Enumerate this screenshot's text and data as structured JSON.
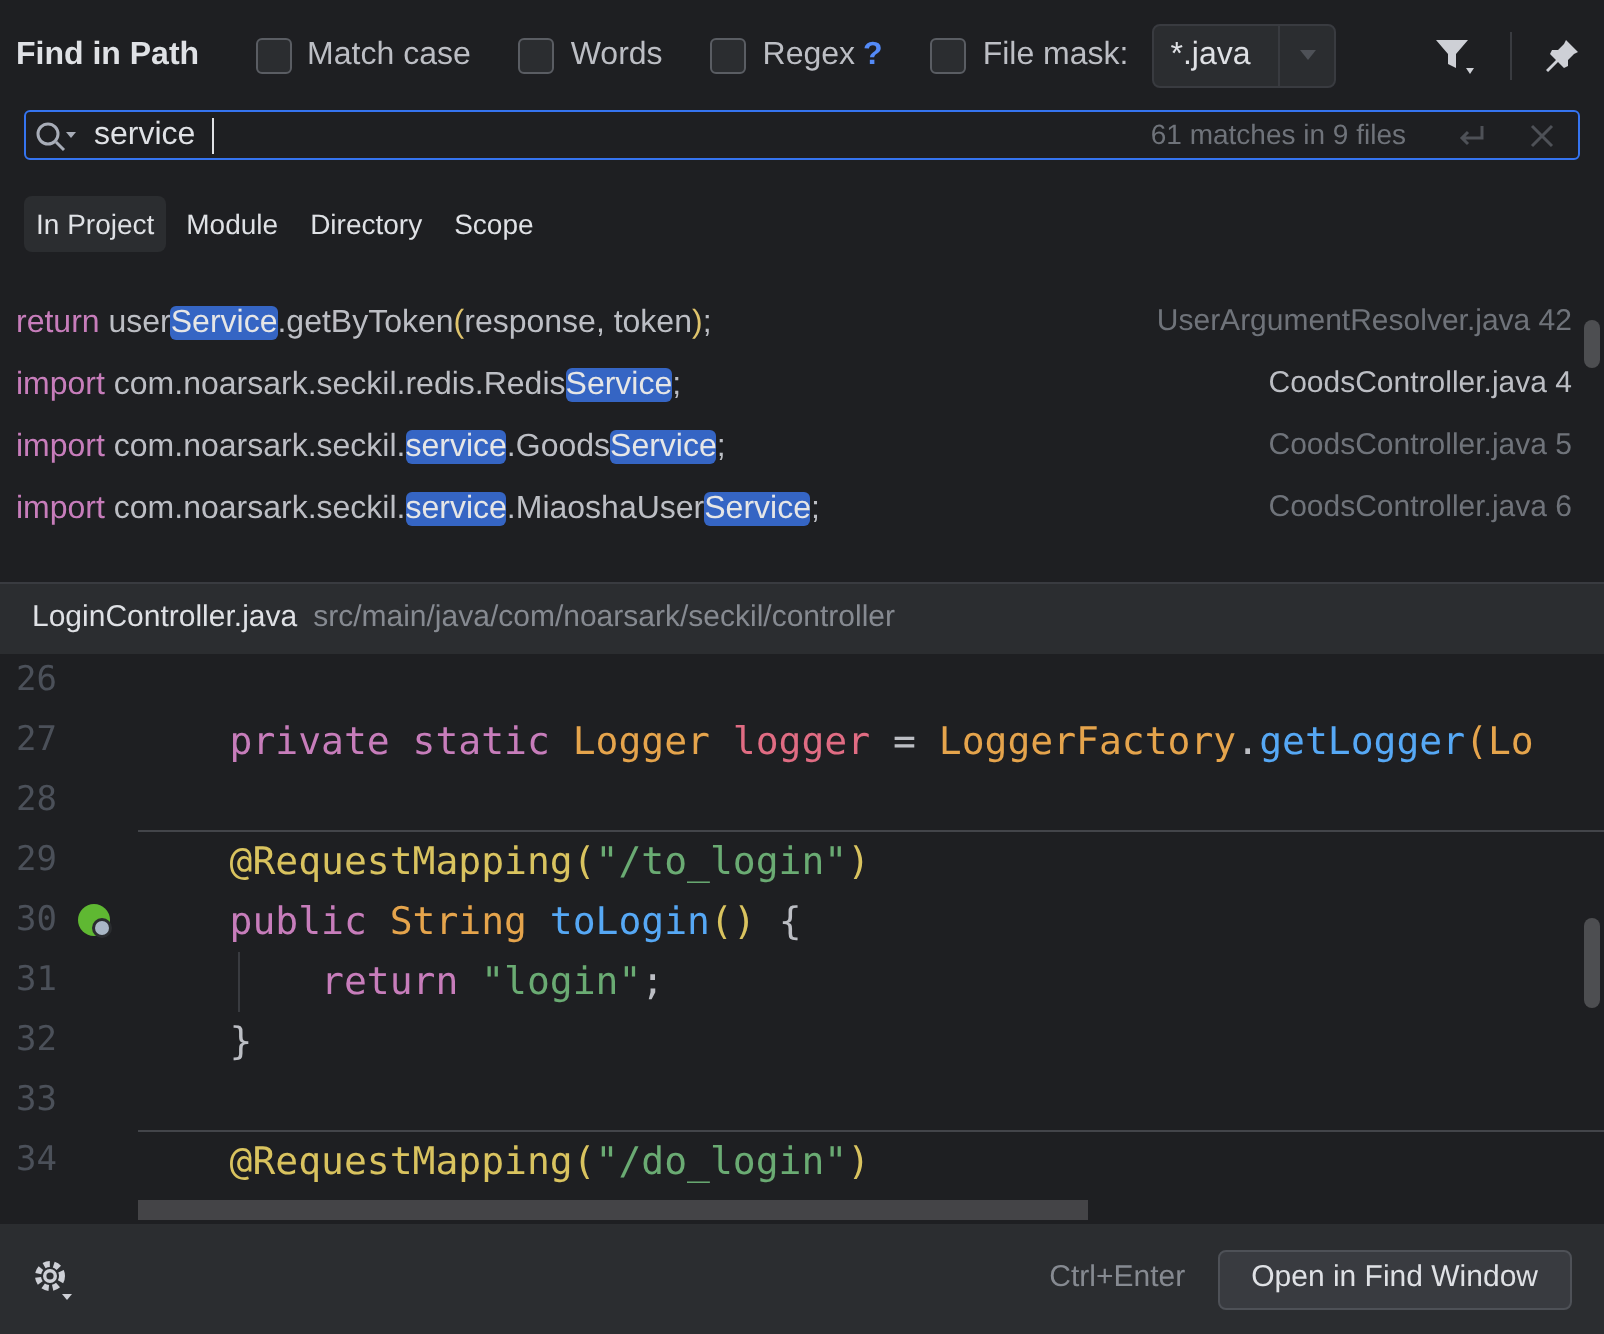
{
  "dialog": {
    "title": "Find in Path"
  },
  "options": [
    {
      "label": "Match case",
      "checked": false
    },
    {
      "label": "Words",
      "checked": false
    },
    {
      "label": "Regex",
      "checked": false,
      "help": "?"
    }
  ],
  "file_mask": {
    "label": "File mask:",
    "checked": false,
    "value": "*.java"
  },
  "search": {
    "value": "service",
    "summary": "61 matches in 9 files"
  },
  "scopes": [
    {
      "label": "In Project",
      "selected": true
    },
    {
      "label": "Module",
      "selected": false
    },
    {
      "label": "Directory",
      "selected": false
    },
    {
      "label": "Scope",
      "selected": false
    }
  ],
  "results": [
    {
      "segments": [
        {
          "kind": "keyword",
          "text": "return "
        },
        {
          "kind": "plain",
          "text": "user"
        },
        {
          "kind": "match",
          "text": "Service"
        },
        {
          "kind": "plain",
          "text": ".getByToken"
        },
        {
          "kind": "paren",
          "text": "("
        },
        {
          "kind": "plain",
          "text": "response, token"
        },
        {
          "kind": "paren",
          "text": ")"
        },
        {
          "kind": "plain",
          "text": ";"
        }
      ],
      "file": "UserArgumentResolver.java 42",
      "selected": false
    },
    {
      "segments": [
        {
          "kind": "keyword",
          "text": "import "
        },
        {
          "kind": "plain",
          "text": "com.noarsark.seckil.redis.Redis"
        },
        {
          "kind": "match",
          "text": "Service"
        },
        {
          "kind": "plain",
          "text": ";"
        }
      ],
      "file": "CoodsController.java 4",
      "selected": true
    },
    {
      "segments": [
        {
          "kind": "keyword",
          "text": "import "
        },
        {
          "kind": "plain",
          "text": "com.noarsark.seckil."
        },
        {
          "kind": "match",
          "text": "service"
        },
        {
          "kind": "plain",
          "text": ".Goods"
        },
        {
          "kind": "match",
          "text": "Service"
        },
        {
          "kind": "plain",
          "text": ";"
        }
      ],
      "file": "CoodsController.java 5",
      "selected": false
    },
    {
      "segments": [
        {
          "kind": "keyword",
          "text": "import "
        },
        {
          "kind": "plain",
          "text": "com.noarsark.seckil."
        },
        {
          "kind": "match",
          "text": "service"
        },
        {
          "kind": "plain",
          "text": ".MiaoshaUser"
        },
        {
          "kind": "match",
          "text": "Service"
        },
        {
          "kind": "plain",
          "text": ";"
        }
      ],
      "file": "CoodsController.java 6",
      "selected": false
    }
  ],
  "preview": {
    "file": "LoginController.java",
    "path": "src/main/java/com/noarsark/seckil/controller"
  },
  "code": [
    {
      "number": "26"
    },
    {
      "number": "27",
      "tokens": [
        {
          "kind": "keyword",
          "text": "    private static "
        },
        {
          "kind": "type",
          "text": "Logger "
        },
        {
          "kind": "field",
          "text": "logger"
        },
        {
          "kind": "plain",
          "text": " = "
        },
        {
          "kind": "type",
          "text": "LoggerFactory"
        },
        {
          "kind": "plain",
          "text": "."
        },
        {
          "kind": "method",
          "text": "getLogger"
        },
        {
          "kind": "type",
          "text": "(Lo"
        }
      ]
    },
    {
      "number": "28",
      "separator": true
    },
    {
      "number": "29",
      "tokens": [
        {
          "kind": "annotation",
          "text": "    @RequestMapping("
        },
        {
          "kind": "string",
          "text": "\"/to_login\""
        },
        {
          "kind": "annotation",
          "text": ")"
        }
      ]
    },
    {
      "number": "30",
      "tokens": [
        {
          "kind": "keyword",
          "text": "    public "
        },
        {
          "kind": "type",
          "text": "String "
        },
        {
          "kind": "method",
          "text": "toLogin"
        },
        {
          "kind": "annotation",
          "text": "()"
        },
        {
          "kind": "plain",
          "text": " {"
        }
      ],
      "gutter_icon": true
    },
    {
      "number": "31",
      "tokens": [
        {
          "kind": "keyword",
          "text": "        return "
        },
        {
          "kind": "string",
          "text": "\"login\""
        },
        {
          "kind": "plain",
          "text": ";"
        }
      ],
      "guide": true
    },
    {
      "number": "32",
      "tokens": [
        {
          "kind": "plain",
          "text": "    }"
        }
      ]
    },
    {
      "number": "33",
      "separator": true
    },
    {
      "number": "34",
      "tokens": [
        {
          "kind": "annotation",
          "text": "    @RequestMapping("
        },
        {
          "kind": "string",
          "text": "\"/do_login\""
        },
        {
          "kind": "annotation",
          "text": ")"
        }
      ]
    }
  ],
  "footer": {
    "shortcut": "Ctrl+Enter",
    "button": "Open in Find Window"
  }
}
